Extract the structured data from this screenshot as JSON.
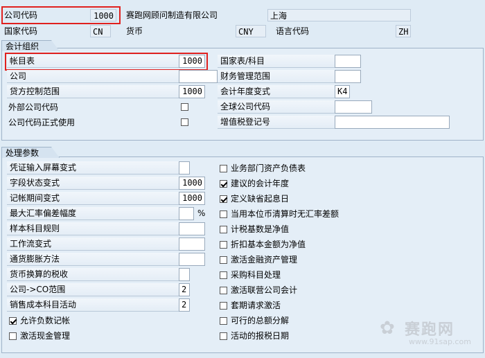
{
  "header": {
    "company_code_label": "公司代码",
    "company_code_value": "1000",
    "company_name": "赛跑网顾问制造有限公司",
    "city": "上海",
    "country_code_label": "国家代码",
    "country_code_value": "CN",
    "currency_label": "货币",
    "currency_value": "CNY",
    "language_code_label": "语言代码",
    "language_code_value": "ZH"
  },
  "accounting": {
    "title": "会计组织",
    "left": [
      {
        "label": "帐目表",
        "value": "1000"
      },
      {
        "label": "公司",
        "value": ""
      },
      {
        "label": "贷方控制范围",
        "value": "1000"
      },
      {
        "label": "外部公司代码",
        "checked": false
      },
      {
        "label": "公司代码正式使用",
        "checked": false
      }
    ],
    "right": [
      {
        "label": "国家表/科目",
        "value": ""
      },
      {
        "label": "财务管理范围",
        "value": ""
      },
      {
        "label": "会计年度变式",
        "value": "K4"
      },
      {
        "label": "全球公司代码",
        "value": ""
      },
      {
        "label": "增值税登记号",
        "value": ""
      }
    ]
  },
  "processing": {
    "title": "处理参数",
    "left": [
      {
        "label": "凭证输入屏幕变式",
        "value": ""
      },
      {
        "label": "字段状态变式",
        "value": "1000"
      },
      {
        "label": "记帐期间变式",
        "value": "1000"
      },
      {
        "label": "最大汇率偏差幅度",
        "value": "",
        "unit": "%"
      },
      {
        "label": "样本科目规则",
        "value": ""
      },
      {
        "label": "工作流变式",
        "value": ""
      },
      {
        "label": "通货膨胀方法",
        "value": ""
      },
      {
        "label": "货币换算的税收",
        "value": ""
      },
      {
        "label": "公司->CO范围",
        "value": "2"
      },
      {
        "label": "销售成本科目活动",
        "value": "2"
      }
    ],
    "left_checks": [
      {
        "label": "允许负数记帐",
        "checked": true
      },
      {
        "label": "激活现金管理",
        "checked": false
      }
    ],
    "right_checks": [
      {
        "label": "业务部门资产负债表",
        "checked": false
      },
      {
        "label": "建议的会计年度",
        "checked": true
      },
      {
        "label": "定义缺省起息日",
        "checked": true
      },
      {
        "label": "当用本位币清算时无汇率差额",
        "checked": false
      },
      {
        "label": "计税基数是净值",
        "checked": false
      },
      {
        "label": "折扣基本金额为净值",
        "checked": false
      },
      {
        "label": "激活金融资产管理",
        "checked": false
      },
      {
        "label": "采购科目处理",
        "checked": false
      },
      {
        "label": "激活联营公司会计",
        "checked": false
      },
      {
        "label": "套期请求激活",
        "checked": false
      },
      {
        "label": "可行的总额分解",
        "checked": false
      },
      {
        "label": "活动的报税日期",
        "checked": false
      }
    ]
  },
  "watermark": {
    "brand": "赛跑网",
    "url": "www.91sap.com"
  }
}
